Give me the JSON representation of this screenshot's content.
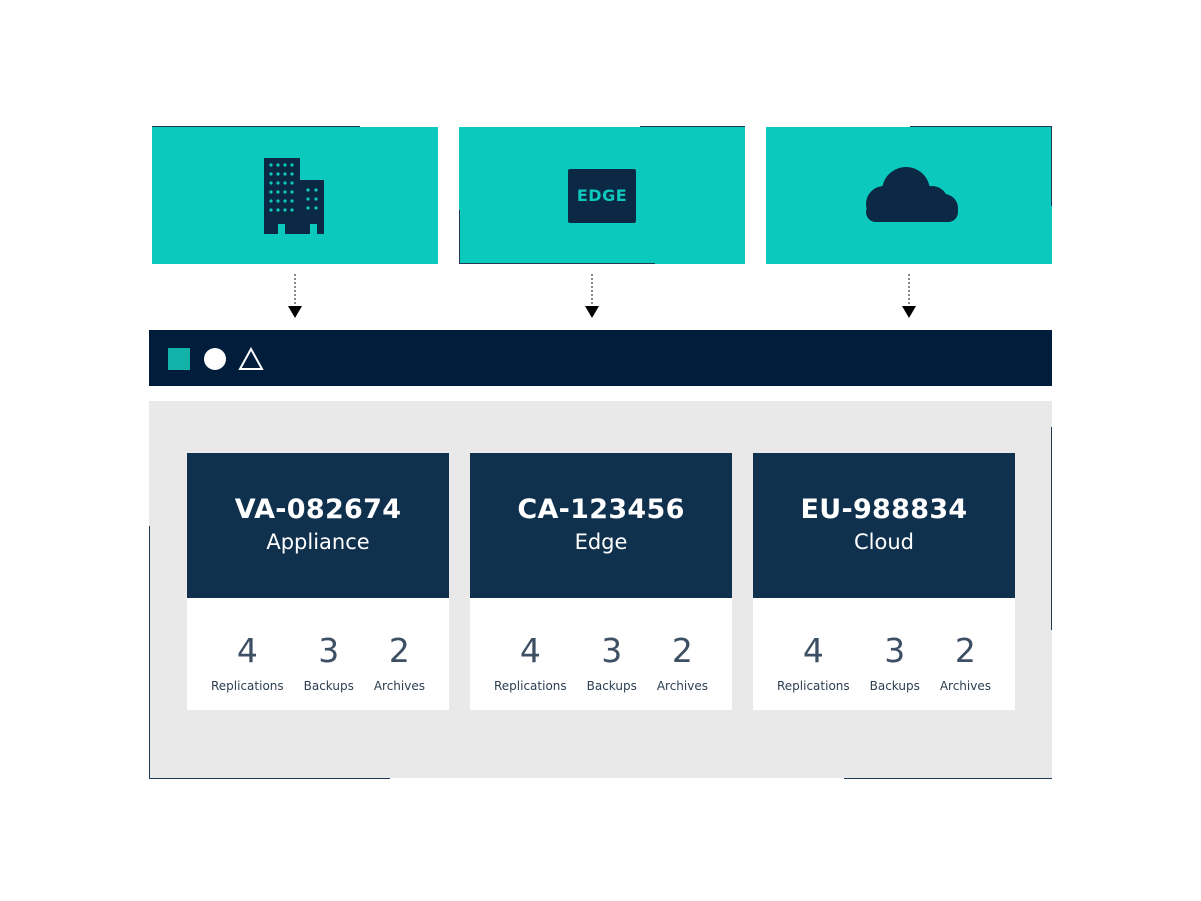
{
  "sources": [
    {
      "name": "appliance",
      "icon": "building-icon"
    },
    {
      "name": "edge",
      "icon": "edge-icon",
      "label": "EDGE"
    },
    {
      "name": "cloud",
      "icon": "cloud-icon"
    }
  ],
  "toolbar": {
    "icons": [
      "square-icon",
      "circle-icon",
      "triangle-icon"
    ]
  },
  "cards": [
    {
      "id": "VA-082674",
      "type": "Appliance",
      "stats": [
        {
          "value": "4",
          "label": "Replications"
        },
        {
          "value": "3",
          "label": "Backups"
        },
        {
          "value": "2",
          "label": "Archives"
        }
      ]
    },
    {
      "id": "CA-123456",
      "type": "Edge",
      "stats": [
        {
          "value": "4",
          "label": "Replications"
        },
        {
          "value": "3",
          "label": "Backups"
        },
        {
          "value": "2",
          "label": "Archives"
        }
      ]
    },
    {
      "id": "EU-988834",
      "type": "Cloud",
      "stats": [
        {
          "value": "4",
          "label": "Replications"
        },
        {
          "value": "3",
          "label": "Backups"
        },
        {
          "value": "2",
          "label": "Archives"
        }
      ]
    }
  ],
  "colors": {
    "teal": "#0cc9bd",
    "navy": "#001e3c",
    "card_navy": "#10314d",
    "panel_gray": "#e9e9e9",
    "accent_square": "#13b2a9"
  }
}
